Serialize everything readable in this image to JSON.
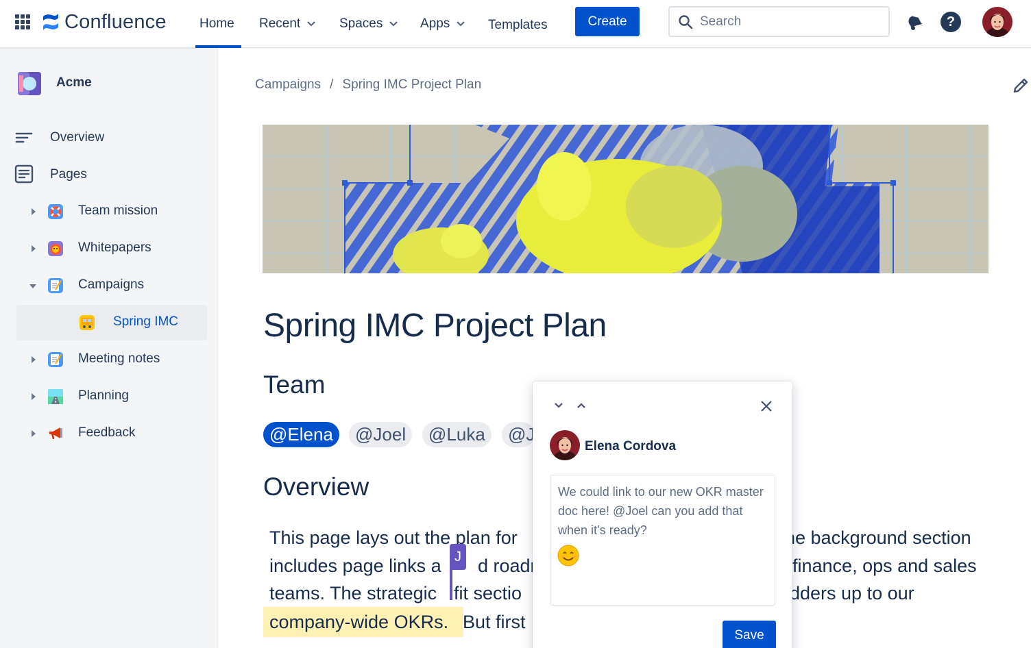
{
  "app": {
    "name": "Confluence"
  },
  "nav": {
    "home": "Home",
    "recent": "Recent",
    "spaces": "Spaces",
    "apps": "Apps",
    "templates": "Templates",
    "create": "Create"
  },
  "search": {
    "placeholder": "Search"
  },
  "help_glyph": "?",
  "sidebar": {
    "space_name": "Acme",
    "overview": "Overview",
    "pages": "Pages",
    "tree": [
      {
        "label": "Team mission",
        "icon": "lifebuoy-icon",
        "state": "collapsed"
      },
      {
        "label": "Whitepapers",
        "icon": "face-icon",
        "state": "collapsed"
      },
      {
        "label": "Campaigns",
        "icon": "memo-icon",
        "state": "expanded"
      },
      {
        "label": "Spring IMC",
        "icon": "bus-icon",
        "state": "selected"
      },
      {
        "label": "Meeting notes",
        "icon": "memo-icon",
        "state": "collapsed"
      },
      {
        "label": "Planning",
        "icon": "road-icon",
        "state": "collapsed"
      },
      {
        "label": "Feedback",
        "icon": "megaphone-icon",
        "state": "collapsed"
      }
    ]
  },
  "breadcrumb": {
    "parent": "Campaigns",
    "separator": "/",
    "current": "Spring IMC Project Plan"
  },
  "page": {
    "title": "Spring IMC Project Plan",
    "team_heading": "Team",
    "mentions": [
      "@Elena",
      "@Joel",
      "@Luka",
      "@J"
    ],
    "overview_heading": "Overview",
    "para_lines": [
      {
        "left": "This page lays out the plan for",
        "right": "ne background section"
      },
      {
        "left": "includes page links a",
        "mid": "d roadm",
        "right": "finance, ops and sales"
      },
      {
        "left": "teams. The strategic",
        "mid": "fit sectio",
        "right": "dders up to our"
      },
      {
        "left": "company-wide OKRs.",
        "mid": "But first"
      }
    ],
    "cursor_initial": "J"
  },
  "comment": {
    "author": "Elena Cordova",
    "text": "We could link to our new OKR master doc here! @Joel can you add that when it’s ready?",
    "emoji": "smiling-face-icon",
    "save": "Save"
  },
  "colors": {
    "brand": "#0052CC",
    "text": "#172B4D",
    "highlight": "#FFF0B3",
    "cursor": "#6554C0"
  }
}
